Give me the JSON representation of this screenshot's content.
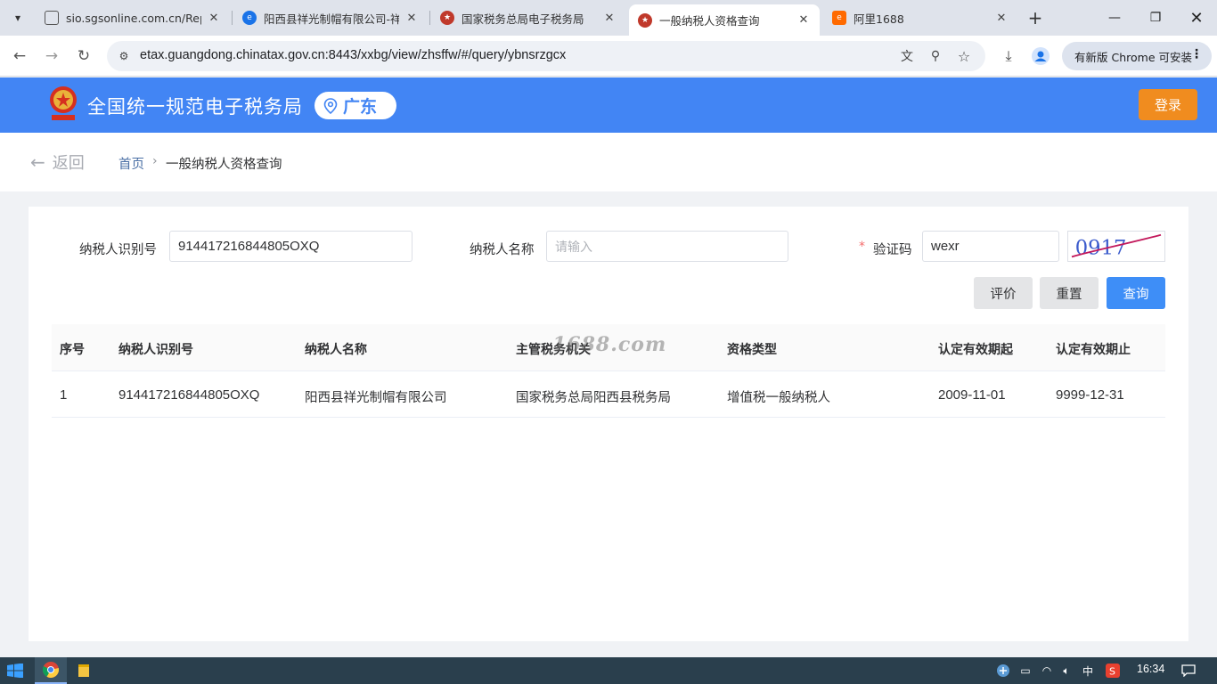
{
  "browser": {
    "tabs": [
      {
        "title": "sio.sgsonline.com.cn/Repo"
      },
      {
        "title": "阳西县祥光制帽有限公司-祥"
      },
      {
        "title": "国家税务总局电子税务局"
      },
      {
        "title": "一般纳税人资格查询"
      },
      {
        "title": "阿里1688"
      }
    ],
    "url": "etax.guangdong.chinatax.gov.cn:8443/xxbg/view/zhsffw/#/query/ybnsrzgcx",
    "update_label": "有新版 Chrome 可安装"
  },
  "header": {
    "title": "全国统一规范电子税务局",
    "region": "广东",
    "login_label": "登录"
  },
  "breadcrumb": {
    "back_label": "返回",
    "home": "首页",
    "sep": "›",
    "current": "一般纳税人资格查询"
  },
  "form": {
    "taxpayer_id_label": "纳税人识别号",
    "taxpayer_id_value": "914417216844805OXQ",
    "taxpayer_name_label": "纳税人名称",
    "taxpayer_name_placeholder": "请输入",
    "captcha_required_mark": "*",
    "captcha_label": "验证码",
    "captcha_value": "wexr",
    "captcha_image_text": "0917"
  },
  "buttons": {
    "evaluate": "评价",
    "reset": "重置",
    "query": "查询"
  },
  "table": {
    "headers": [
      "序号",
      "纳税人识别号",
      "纳税人名称",
      "主管税务机关",
      "资格类型",
      "认定有效期起",
      "认定有效期止"
    ],
    "rows": [
      [
        "1",
        "914417216844805OXQ",
        "阳西县祥光制帽有限公司",
        "国家税务总局阳西县税务局",
        "增值税一般纳税人",
        "2009-11-01",
        "9999-12-31"
      ]
    ]
  },
  "watermark": "1688.com",
  "taskbar": {
    "time": "16:34",
    "ime": "中"
  },
  "colors": {
    "header_blue": "#4285f4",
    "login_orange": "#f08c1f",
    "query_blue": "#3e8ef7"
  }
}
